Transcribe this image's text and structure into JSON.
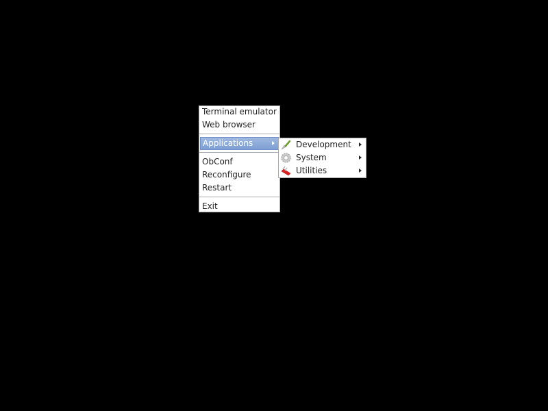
{
  "root_menu": {
    "groups": [
      [
        {
          "label": "Terminal emulator"
        },
        {
          "label": "Web browser"
        }
      ],
      [
        {
          "label": "Applications",
          "submenu": true,
          "active": true
        }
      ],
      [
        {
          "label": "ObConf"
        },
        {
          "label": "Reconfigure"
        },
        {
          "label": "Restart"
        }
      ],
      [
        {
          "label": "Exit"
        }
      ]
    ]
  },
  "applications_submenu": {
    "items": [
      {
        "label": "Development",
        "icon": "trowel-icon",
        "submenu": true
      },
      {
        "label": "System",
        "icon": "gear-icon",
        "submenu": true
      },
      {
        "label": "Utilities",
        "icon": "swiss-knife-icon",
        "submenu": true
      }
    ]
  },
  "colors": {
    "highlight": "#8aa9d9",
    "desktop": "#000000",
    "menu_bg": "#ffffff",
    "border": "#aaaaaa"
  }
}
